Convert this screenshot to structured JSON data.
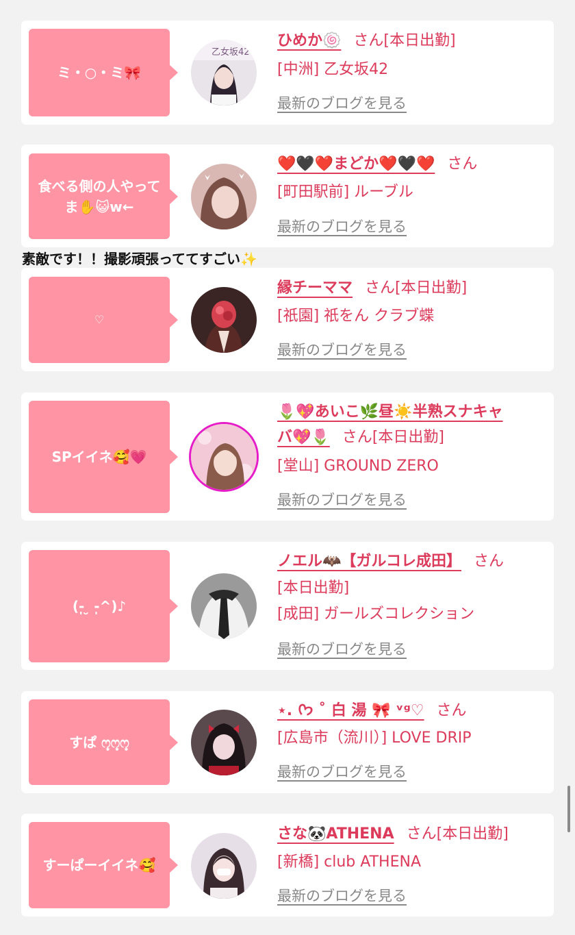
{
  "entries": [
    {
      "bubble": "ミ・○・ミ🎀",
      "name": "ひめか🍥",
      "san": "さん",
      "status": "[本日出勤]",
      "shop": "[中洲] 乙女坂42",
      "blog": "最新のブログを見る",
      "avatar_bg": "#e8e4ea",
      "avatar_fg": "#2c2230"
    },
    {
      "bubble": "食べる側の人やってま✋😺w←",
      "name": "❤️🖤❤️まどか❤️🖤❤️",
      "san": "さん",
      "shop": "[町田駅前] ルーブル",
      "blog": "最新のブログを見る",
      "avatar_bg": "#d9b8b4",
      "avatar_fg": "#7a5046"
    },
    {
      "bubble": "♡",
      "name": "縁チーママ",
      "san": "さん",
      "status": "[本日出勤]",
      "shop": "[祇園] 祇をん クラブ蝶",
      "blog": "最新のブログを見る",
      "avatar_bg": "#3a2424",
      "avatar_fg": "#d6424f"
    },
    {
      "bubble": "SPイイネ🥰💗",
      "name_line1": "🌷💖あいこ🌿昼☀️半熟スナキャ",
      "name_line2": "バ💖🌷",
      "san": "さん",
      "status": "[本日出勤]",
      "shop": "[堂山] GROUND ZERO",
      "blog": "最新のブログを見る",
      "avatar_bg": "#f3c9d8",
      "avatar_fg": "#8a5a4a",
      "avatar_ring": "#e51cc8"
    },
    {
      "bubble": "(-̩̩̩-̩̩̩-̩̩̩-̩̩̩-̩̩̩___-̩̩̩-̩̩̩-̩̩̩-̩̩̩-̩̩̩)♪",
      "bubble_display": "(-̩̩̩ ̮ -̩̩̩^)♪",
      "name": "ノエル🦇【ガルコレ成田】",
      "san": "さん",
      "status": "[本日出勤]",
      "shop": "[成田] ガールズコレクション",
      "blog": "最新のブログを見る",
      "avatar_bg": "#9a9a9a",
      "avatar_fg": "#f1f1f1"
    },
    {
      "bubble": "すぱ ꒰ ͈ ᐢ ͈꒱",
      "bubble_display": "すぱ ෆ͙ෆ͙ෆ͙",
      "name": "⋆. ᢉ𐭩 ˚ 白 湯 🎀 ᵛᵍ♡",
      "san": "さん",
      "shop": "[広島市（流川）] LOVE DRIP",
      "blog": "最新のブログを見る",
      "avatar_bg": "#5a4a4e",
      "avatar_fg": "#f0d8dc"
    },
    {
      "bubble": "すーぱーイイネ🥰",
      "name": "さな🐼ATHENA",
      "san": "さん",
      "status": "[本日出勤]",
      "shop": "[新橋] club ATHENA",
      "blog": "最新のブログを見る",
      "avatar_bg": "#e7dfe8",
      "avatar_fg": "#3a2a30"
    }
  ],
  "comment": "素敵です！！撮影頑張っててすごい✨",
  "colors": {
    "accent": "#dc3b5b",
    "bubble": "#ff95a4",
    "link_gray": "#888888",
    "background": "#f2f2f2"
  }
}
